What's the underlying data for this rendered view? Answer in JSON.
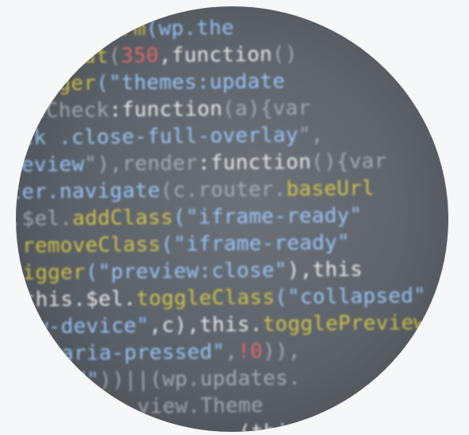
{
  "avatar": {
    "alt_label": "Code avatar",
    "lines": [
      [
        {
          "text": "     ",
          "c": "c-gray"
        },
        {
          "text": "confirm",
          "c": "c-yellow"
        },
        {
          "text": "(wp.the",
          "c": "c-cyan"
        }
      ],
      [
        {
          "text": "   ",
          "c": "c-gray"
        },
        {
          "text": "adeOut",
          "c": "c-yellow"
        },
        {
          "text": "(",
          "c": "c-gray"
        },
        {
          "text": "350",
          "c": "c-red"
        },
        {
          "text": ",function",
          "c": "c-white"
        },
        {
          "text": "()",
          "c": "c-gray"
        }
      ],
      [
        {
          "text": "  ",
          "c": "c-gray"
        },
        {
          "text": "rigger",
          "c": "c-yellow"
        },
        {
          "text": "(\"themes:update",
          "c": "c-cyan"
        }
      ],
      [
        {
          "text": "  ",
          "c": "c-gray"
        },
        {
          "text": "otCheck",
          "c": "c-gray"
        },
        {
          "text": ":function",
          "c": "c-white"
        },
        {
          "text": "(a){var",
          "c": "c-gray"
        }
      ],
      [
        {
          "text": "  ",
          "c": "c-gray"
        },
        {
          "text": "ck .close-full-overlay",
          "c": "c-cyan"
        },
        {
          "text": "\",",
          "c": "c-gray"
        }
      ],
      [
        {
          "text": " ",
          "c": "c-gray"
        },
        {
          "text": "review",
          "c": "c-cyan"
        },
        {
          "text": "\"),render",
          "c": "c-gray"
        },
        {
          "text": ":function",
          "c": "c-white"
        },
        {
          "text": "(){var",
          "c": "c-gray"
        }
      ],
      [
        {
          "text": " ",
          "c": "c-gray"
        },
        {
          "text": "ter.navigate",
          "c": "c-cyan"
        },
        {
          "text": "(c.router.",
          "c": "c-gray"
        },
        {
          "text": "baseUrl",
          "c": "c-yellow"
        }
      ],
      [
        {
          "text": " ",
          "c": "c-gray"
        },
        {
          "text": ".$el.",
          "c": "c-gray"
        },
        {
          "text": "addClass",
          "c": "c-yellow"
        },
        {
          "text": "(\"iframe-ready\"",
          "c": "c-cyan"
        }
      ],
      [
        {
          "text": " ",
          "c": "c-gray"
        },
        {
          "text": ".",
          "c": "c-gray"
        },
        {
          "text": "removeClass",
          "c": "c-yellow"
        },
        {
          "text": "(\"iframe-ready\"",
          "c": "c-cyan"
        }
      ],
      [
        {
          "text": " ",
          "c": "c-gray"
        },
        {
          "text": "rigger",
          "c": "c-yellow"
        },
        {
          "text": "(\"preview:close\"",
          "c": "c-cyan"
        },
        {
          "text": "),this",
          "c": "c-white"
        }
      ],
      [
        {
          "text": "  ",
          "c": "c-gray"
        },
        {
          "text": "this.$el.",
          "c": "c-white"
        },
        {
          "text": "toggleClass",
          "c": "c-yellow"
        },
        {
          "text": "(\"collapsed\"",
          "c": "c-cyan"
        }
      ],
      [
        {
          "text": "  ",
          "c": "c-gray"
        },
        {
          "text": "ew-device\"",
          "c": "c-cyan"
        },
        {
          "text": ",c),this.",
          "c": "c-white"
        },
        {
          "text": "togglePreview",
          "c": "c-yellow"
        }
      ],
      [
        {
          "text": "  ",
          "c": "c-gray"
        },
        {
          "text": "r(\"aria-pressed\"",
          "c": "c-cyan"
        },
        {
          "text": ",",
          "c": "c-gray"
        },
        {
          "text": "!0",
          "c": "c-red"
        },
        {
          "text": ")),",
          "c": "c-gray"
        }
      ],
      [
        {
          "text": "  ",
          "c": "c-gray"
        },
        {
          "text": "abled\"",
          "c": "c-cyan"
        },
        {
          "text": "))||(wp.updates.",
          "c": "c-gray"
        }
      ],
      [
        {
          "text": "           ",
          "c": "c-gray"
        },
        {
          "text": "view.Theme",
          "c": "c-gray"
        }
      ],
      [
        {
          "text": "                   ",
          "c": "c-gray"
        },
        {
          "text": "(this.",
          "c": "c-white"
        }
      ]
    ]
  }
}
